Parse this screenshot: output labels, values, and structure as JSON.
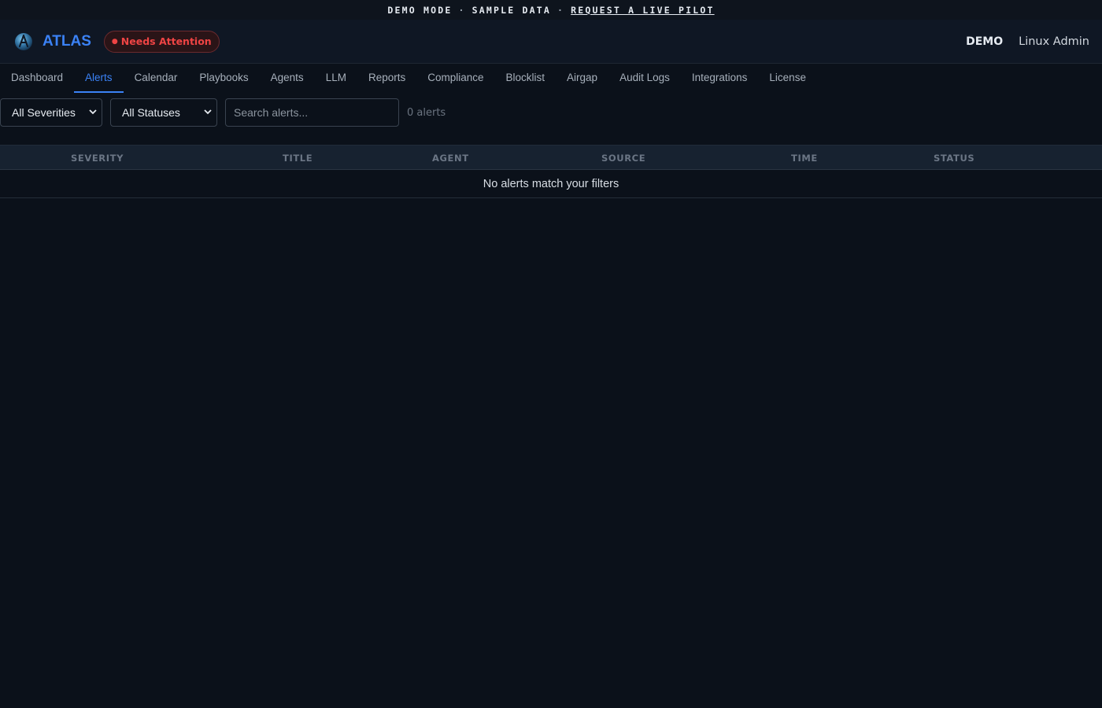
{
  "banner": {
    "mode": "DEMO MODE",
    "data": "SAMPLE DATA",
    "separator": "·",
    "cta": "REQUEST A LIVE PILOT"
  },
  "header": {
    "brand": "ATLAS",
    "logo_icon": "globe-atlas-icon",
    "badge": {
      "dot": "●",
      "label": "Needs Attention"
    },
    "demo_label": "DEMO",
    "user": "Linux Admin"
  },
  "tabs": [
    {
      "label": "Dashboard",
      "active": false
    },
    {
      "label": "Alerts",
      "active": true
    },
    {
      "label": "Calendar",
      "active": false
    },
    {
      "label": "Playbooks",
      "active": false
    },
    {
      "label": "Agents",
      "active": false
    },
    {
      "label": "LLM",
      "active": false
    },
    {
      "label": "Reports",
      "active": false
    },
    {
      "label": "Compliance",
      "active": false
    },
    {
      "label": "Blocklist",
      "active": false
    },
    {
      "label": "Airgap",
      "active": false
    },
    {
      "label": "Audit Logs",
      "active": false
    },
    {
      "label": "Integrations",
      "active": false
    },
    {
      "label": "License",
      "active": false
    }
  ],
  "filters": {
    "severity": "All Severities",
    "status": "All Statuses",
    "search_placeholder": "Search alerts...",
    "count": "0 alerts"
  },
  "table": {
    "columns": [
      "SEVERITY",
      "TITLE",
      "AGENT",
      "SOURCE",
      "TIME",
      "STATUS"
    ],
    "empty_message": "No alerts match your filters"
  },
  "colors": {
    "accent": "#3b82f6",
    "danger": "#ef4444",
    "background": "#0b111a"
  }
}
